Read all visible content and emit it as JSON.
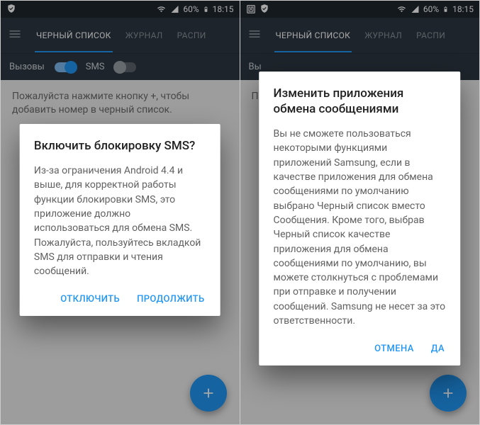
{
  "status": {
    "battery_text": "60%",
    "time": "18:15"
  },
  "tabs": {
    "blacklist": "ЧЕРНЫЙ СПИСОК",
    "log": "ЖУРНАЛ",
    "schedule": "РАСПИ"
  },
  "filter": {
    "calls": "Вызовы",
    "sms": "SMS"
  },
  "screen_left": {
    "hint": "Пожалуйста нажмите кнопку +, чтобы добавить номер в черный список.",
    "dialog": {
      "title": "Включить блокировку SMS?",
      "body": "Из-за ограничения Android 4.4 и выше, для корректной работы функции блокировки SMS, это приложение должно использоваться для обмена SMS. Пожалуйста, пользуйтесь вкладкой SMS для отправки и чтения сообщений.",
      "btn_negative": "ОТКЛЮЧИТЬ",
      "btn_positive": "ПРОДОЛЖИТЬ"
    }
  },
  "screen_right": {
    "filter_prefix": "Вы",
    "hint_prefix": "П д",
    "dialog": {
      "title": "Изменить приложения обмена сообщениями",
      "body": "Вы не сможете пользоваться некоторыми функциями приложений Samsung, если в качестве приложения для обмена сообщениями по умолчанию выбрано Черный список вместо Сообщения. Кроме того, выбрав Черный список качестве приложения для обмена сообщениями по умолчанию, вы можете столкнуться с проблемами при отправке и получении сообщений. Samsung не несет за это ответственности.",
      "btn_negative": "ОТМЕНА",
      "btn_positive": "ДА"
    }
  }
}
